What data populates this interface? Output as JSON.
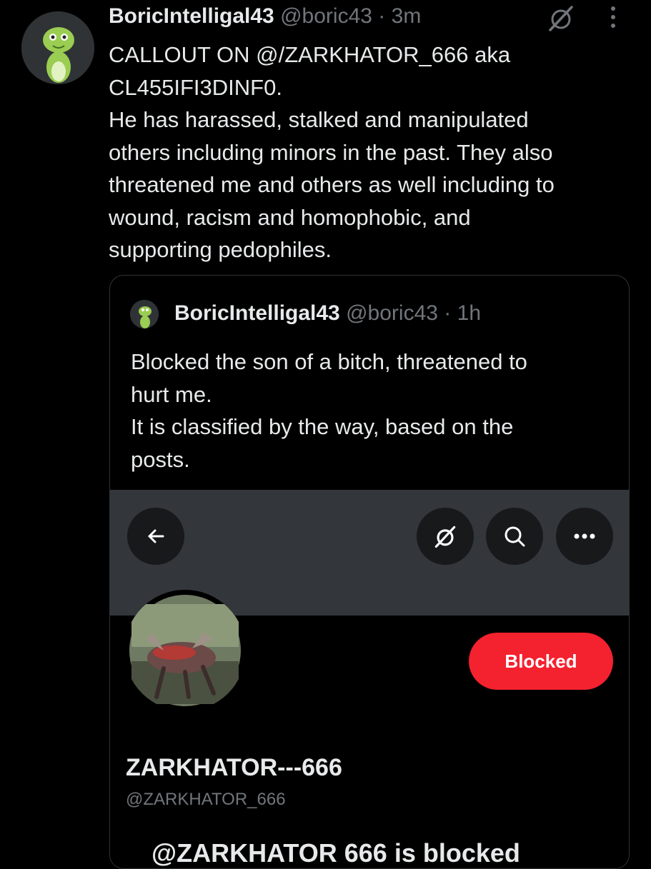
{
  "post": {
    "author_name": "BoricIntelligal43",
    "handle": "@boric43",
    "separator": "·",
    "time": "3m",
    "text": "CALLOUT ON @/ZARKHATOR_666 aka\nCL455IFI3DINF0.\nHe has harassed, stalked and manipulated\nothers including minors in the past. They also\nthreatened me and others as well including to\nwound, racism and homophobic, and\nsupporting pedophiles."
  },
  "quote": {
    "author_name": "BoricIntelligal43",
    "handle": "@boric43",
    "separator": "·",
    "time": "1h",
    "text": "Blocked the son of a bitch, threatened to\nhurt me.\nIt is classified by the way, based on the\nposts.",
    "screenshot": {
      "blocked_label": "Blocked",
      "profile_name": "ZARKHATOR---666",
      "profile_handle": "@ZARKHATOR_666",
      "blocked_notice": "@ZARKHATOR 666 is blocked"
    }
  },
  "icons": {
    "top_right": [
      "grok-icon",
      "more-vertical-icon"
    ],
    "toolbar": [
      "back-arrow-icon",
      "grok-icon",
      "search-icon",
      "more-horizontal-icon"
    ]
  },
  "colors": {
    "background": "#000000",
    "text": "#e7e9ea",
    "muted": "#71767b",
    "blocked_button": "#f4212e",
    "banner": "#33363a"
  }
}
